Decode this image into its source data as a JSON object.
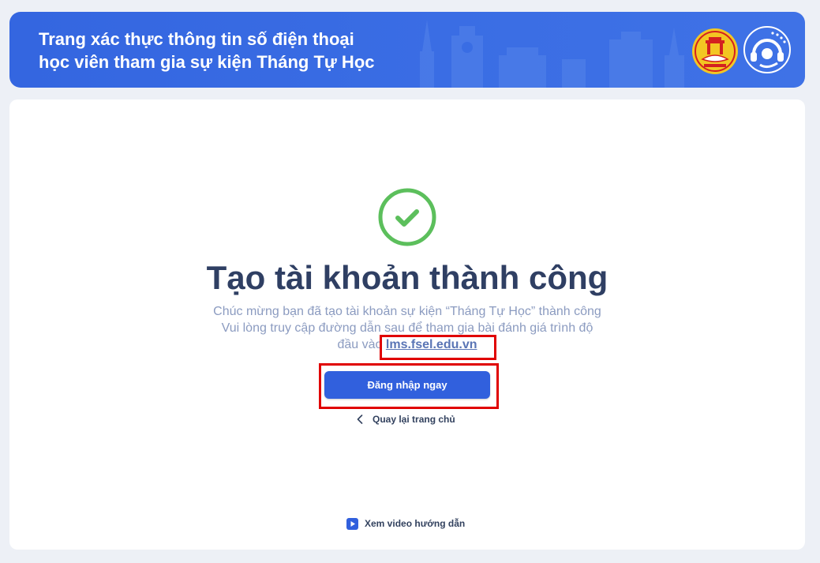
{
  "header": {
    "title_line1": "Trang xác thực thông tin số điện thoại",
    "title_line2": "học viên tham gia sự kiện Tháng Tự Học",
    "logos": [
      "hanoi-education-logo",
      "service-headset-logo"
    ]
  },
  "result": {
    "icon": "check-circle-icon",
    "title": "Tạo tài khoản thành công",
    "message_line1": "Chúc mừng bạn đã tạo tài khoản sự kiện “Tháng Tự Học” thành công",
    "message_line2": "Vui lòng truy cập đường dẫn sau để tham gia bài đánh giá trình độ",
    "message_line3_prefix": "đầu vào ",
    "link_text": "lms.fsel.edu.vn"
  },
  "actions": {
    "login_label": "Đăng nhập ngay",
    "back_label": "Quay lại trang chủ",
    "video_label": "Xem video hướng dẫn"
  },
  "colors": {
    "header_bg": "#3466e0",
    "title_text": "#2f3f63",
    "message_text": "#8b9bc0",
    "success_green": "#5cbf5c",
    "button_bg": "#3160dd",
    "highlight_red": "#e00000"
  }
}
